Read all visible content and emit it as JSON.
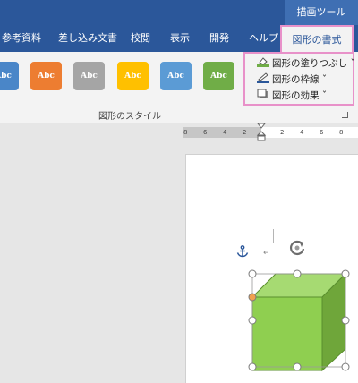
{
  "titlebar": {
    "context_label": "描画ツール",
    "color": "#2b579a"
  },
  "tabs": [
    {
      "label": "参考資料"
    },
    {
      "label": "差し込み文書"
    },
    {
      "label": "校閲"
    },
    {
      "label": "表示"
    },
    {
      "label": "開発"
    },
    {
      "label": "ヘルプ"
    }
  ],
  "active_tab": {
    "label": "図形の書式"
  },
  "ribbon": {
    "styles": [
      {
        "text": "Abc",
        "color": "#4a86c8"
      },
      {
        "text": "Abc",
        "color": "#ed7d31"
      },
      {
        "text": "Abc",
        "color": "#a5a5a5"
      },
      {
        "text": "Abc",
        "color": "#ffc000"
      },
      {
        "text": "Abc",
        "color": "#5b9bd5"
      },
      {
        "text": "Abc",
        "color": "#70ad47"
      }
    ],
    "group_label": "図形のスタイル",
    "format_menu": [
      {
        "label": "図形の塗りつぶし ˇ",
        "icon": "fill-bucket-icon"
      },
      {
        "label": "図形の枠線 ˇ",
        "icon": "pen-outline-icon"
      },
      {
        "label": "図形の効果 ˇ",
        "icon": "shape-effects-icon"
      }
    ],
    "highlight_color": "#e891c9"
  },
  "ruler": {
    "numbers": [
      "8",
      "6",
      "4",
      "2",
      "2",
      "4",
      "6",
      "8"
    ]
  },
  "document": {
    "paragraph_mark": "↵",
    "shape": {
      "type": "cube",
      "front_color": "#8fcf50",
      "top_color": "#a6da72",
      "side_color": "#6fa63a",
      "outline_color": "#5a8f2e"
    }
  }
}
